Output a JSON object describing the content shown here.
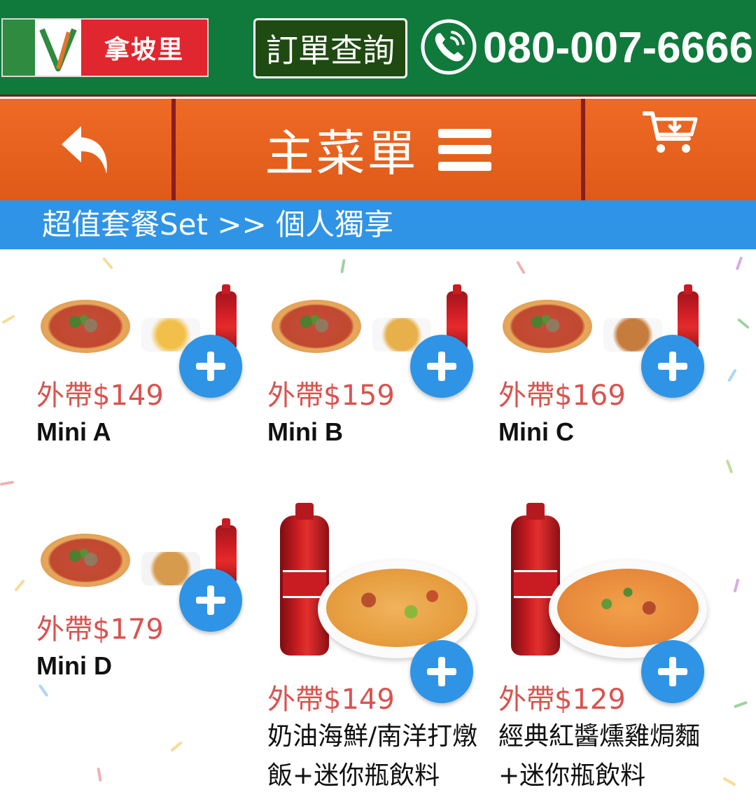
{
  "header": {
    "logo_text": "拿坡里",
    "order_query_label": "訂單查詢",
    "phone_number": "080-007-6666"
  },
  "nav": {
    "menu_title": "主菜單"
  },
  "breadcrumb": {
    "text": "超值套餐Set >> 個人獨享"
  },
  "items": [
    {
      "price": "外帶$149",
      "name": "Mini A",
      "side": "fries"
    },
    {
      "price": "外帶$159",
      "name": "Mini B",
      "side": "nuggets"
    },
    {
      "price": "外帶$169",
      "name": "Mini C",
      "side": "wings"
    },
    {
      "price": "外帶$179",
      "name": "Mini D",
      "side": "chicken"
    },
    {
      "price": "外帶$149",
      "name": "奶油海鮮/南洋打燉飯+迷你瓶飲料",
      "side": "seafood-rice"
    },
    {
      "price": "外帶$129",
      "name": "經典紅醬燻雞焗麵+迷你瓶飲料",
      "side": "chicken-pasta"
    }
  ],
  "colors": {
    "topbar": "#0f7a3b",
    "navbar": "#e8611e",
    "breadcrumb": "#2f94e5",
    "price": "#d9534f",
    "add_button": "#2f94e5"
  }
}
